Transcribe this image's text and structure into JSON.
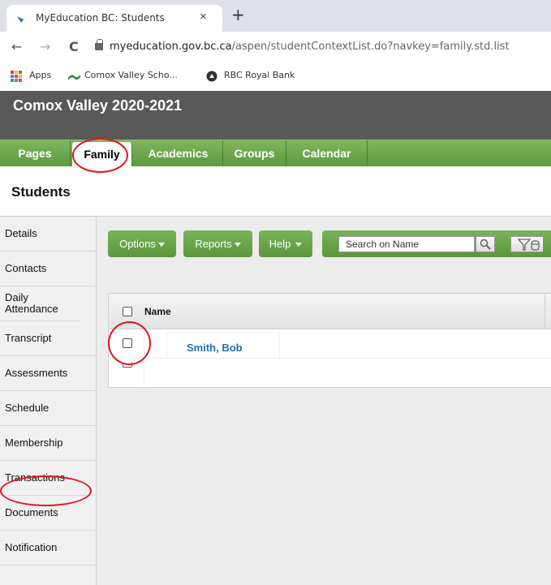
{
  "browser": {
    "tab_title": "MyEducation BC: Students",
    "tab_close": "×",
    "new_tab": "+",
    "back": "←",
    "forward": "→",
    "reload": "C",
    "url_host": "myeducation.gov.bc.ca",
    "url_path": "/aspen/studentContextList.do?navkey=family.std.list",
    "bookmarks": [
      "Apps",
      "Comox Valley Scho...",
      "RBC Royal Bank"
    ]
  },
  "app": {
    "title": "Comox Valley 2020-2021"
  },
  "nav": {
    "tabs": [
      "Pages",
      "Family",
      "Academics",
      "Groups",
      "Calendar"
    ],
    "active": "Family"
  },
  "page": {
    "title": "Students"
  },
  "sidebar": {
    "items": [
      "Details",
      "Contacts",
      "Daily Attendance",
      "Transcript",
      "Assessments",
      "Schedule",
      "Membership",
      "Transactions",
      "Documents",
      "Notification"
    ]
  },
  "toolbar": {
    "options_label": "Options",
    "reports_label": "Reports",
    "help_label": "Help",
    "search_placeholder": "Search on Name"
  },
  "grid": {
    "columns": [
      "Name"
    ],
    "rows": [
      {
        "name": "Smith, Bob",
        "checked": false
      }
    ]
  },
  "colors": {
    "header_bg": "#595959",
    "nav_green": "#5e9a3f",
    "link_blue": "#1f6fb2",
    "annotation_red": "#e0141e"
  },
  "icons": [
    "myeducation-favicon",
    "lock-icon",
    "apps-grid-icon",
    "comox-bookmark-icon",
    "rbc-bookmark-icon",
    "search-icon",
    "filter-icon",
    "dropdown-caret-icon"
  ]
}
